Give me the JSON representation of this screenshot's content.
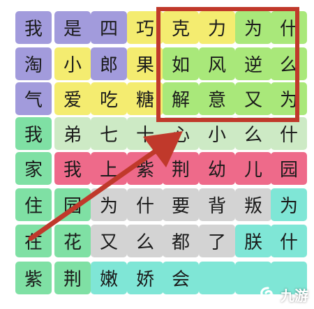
{
  "board": {
    "rows": [
      [
        {
          "ch": "我",
          "color": "#a29bdc"
        },
        {
          "ch": "是",
          "color": "#a29bdc"
        },
        {
          "ch": "四",
          "color": "#a29bdc"
        },
        {
          "ch": "巧",
          "color": "#f4ec70"
        },
        {
          "ch": "克",
          "color": "#f4ec70"
        },
        {
          "ch": "力",
          "color": "#f4ec70"
        },
        {
          "ch": "为",
          "color": "#a9e87a"
        },
        {
          "ch": "什",
          "color": "#a9e87a"
        }
      ],
      [
        {
          "ch": "淘",
          "color": "#a29bdc"
        },
        {
          "ch": "小",
          "color": "#f4ec70"
        },
        {
          "ch": "郎",
          "color": "#a29bdc"
        },
        {
          "ch": "果",
          "color": "#f4ec70"
        },
        {
          "ch": "如",
          "color": "#a9e87a"
        },
        {
          "ch": "风",
          "color": "#a9e87a"
        },
        {
          "ch": "逆",
          "color": "#a9e87a"
        },
        {
          "ch": "么",
          "color": "#a9e87a"
        }
      ],
      [
        {
          "ch": "气",
          "color": "#a29bdc"
        },
        {
          "ch": "爱",
          "color": "#f4ec70"
        },
        {
          "ch": "吃",
          "color": "#f4ec70"
        },
        {
          "ch": "糖",
          "color": "#f4ec70"
        },
        {
          "ch": "解",
          "color": "#a9e87a"
        },
        {
          "ch": "意",
          "color": "#a9e87a"
        },
        {
          "ch": "又",
          "color": "#a9e87a"
        },
        {
          "ch": "为",
          "color": "#a9e87a"
        }
      ],
      [
        {
          "ch": "我",
          "color": "#7fe0a4"
        },
        {
          "ch": "弟",
          "color": "#cdeac5"
        },
        {
          "ch": "七",
          "color": "#cdeac5"
        },
        {
          "ch": "十",
          "color": "#cdeac5"
        },
        {
          "ch": "心",
          "color": "#cdeac5"
        },
        {
          "ch": "小",
          "color": "#cdeac5"
        },
        {
          "ch": "么",
          "color": "#cdeac5"
        },
        {
          "ch": "什",
          "color": "#cdeac5"
        }
      ],
      [
        {
          "ch": "家",
          "color": "#7fe0a4"
        },
        {
          "ch": "我",
          "color": "#ee6a8a"
        },
        {
          "ch": "上",
          "color": "#ee6a8a"
        },
        {
          "ch": "紫",
          "color": "#ee6a8a"
        },
        {
          "ch": "荆",
          "color": "#ee6a8a"
        },
        {
          "ch": "幼",
          "color": "#ee6a8a"
        },
        {
          "ch": "儿",
          "color": "#ee6a8a"
        },
        {
          "ch": "园",
          "color": "#ee6a8a"
        }
      ],
      [
        {
          "ch": "住",
          "color": "#7fe0a4"
        },
        {
          "ch": "园",
          "color": "#7fe0a4"
        },
        {
          "ch": "为",
          "color": "#d3d3d3"
        },
        {
          "ch": "什",
          "color": "#d3d3d3"
        },
        {
          "ch": "要",
          "color": "#d3d3d3"
        },
        {
          "ch": "背",
          "color": "#d3d3d3"
        },
        {
          "ch": "叛",
          "color": "#d3d3d3"
        },
        {
          "ch": "为",
          "color": "#7fe6d6"
        }
      ],
      [
        {
          "ch": "在",
          "color": "#7fe0a4"
        },
        {
          "ch": "花",
          "color": "#7fe0a4"
        },
        {
          "ch": "又",
          "color": "#d3d3d3"
        },
        {
          "ch": "么",
          "color": "#d3d3d3"
        },
        {
          "ch": "都",
          "color": "#d3d3d3"
        },
        {
          "ch": "了",
          "color": "#d3d3d3"
        },
        {
          "ch": "朕",
          "color": "#7fe6d6"
        },
        {
          "ch": "什",
          "color": "#7fe6d6"
        }
      ],
      [
        {
          "ch": "紫",
          "color": "#7fe0a4"
        },
        {
          "ch": "荆",
          "color": "#7fe0a4"
        },
        {
          "ch": "嫩",
          "color": "#7fe6d6"
        },
        {
          "ch": "娇",
          "color": "#7fe6d6"
        },
        {
          "ch": "会",
          "color": "#7fe6d6"
        },
        {
          "ch": "",
          "color": "#7fe6d6"
        },
        {
          "ch": "",
          "color": "#7fe6d6"
        },
        {
          "ch": "",
          "color": "#7fe6d6"
        }
      ]
    ]
  },
  "watermark": {
    "text": "九游",
    "logo": "swirl-logo"
  },
  "colors": {
    "highlight": "#c0392b",
    "arrow": "#c0392b"
  }
}
